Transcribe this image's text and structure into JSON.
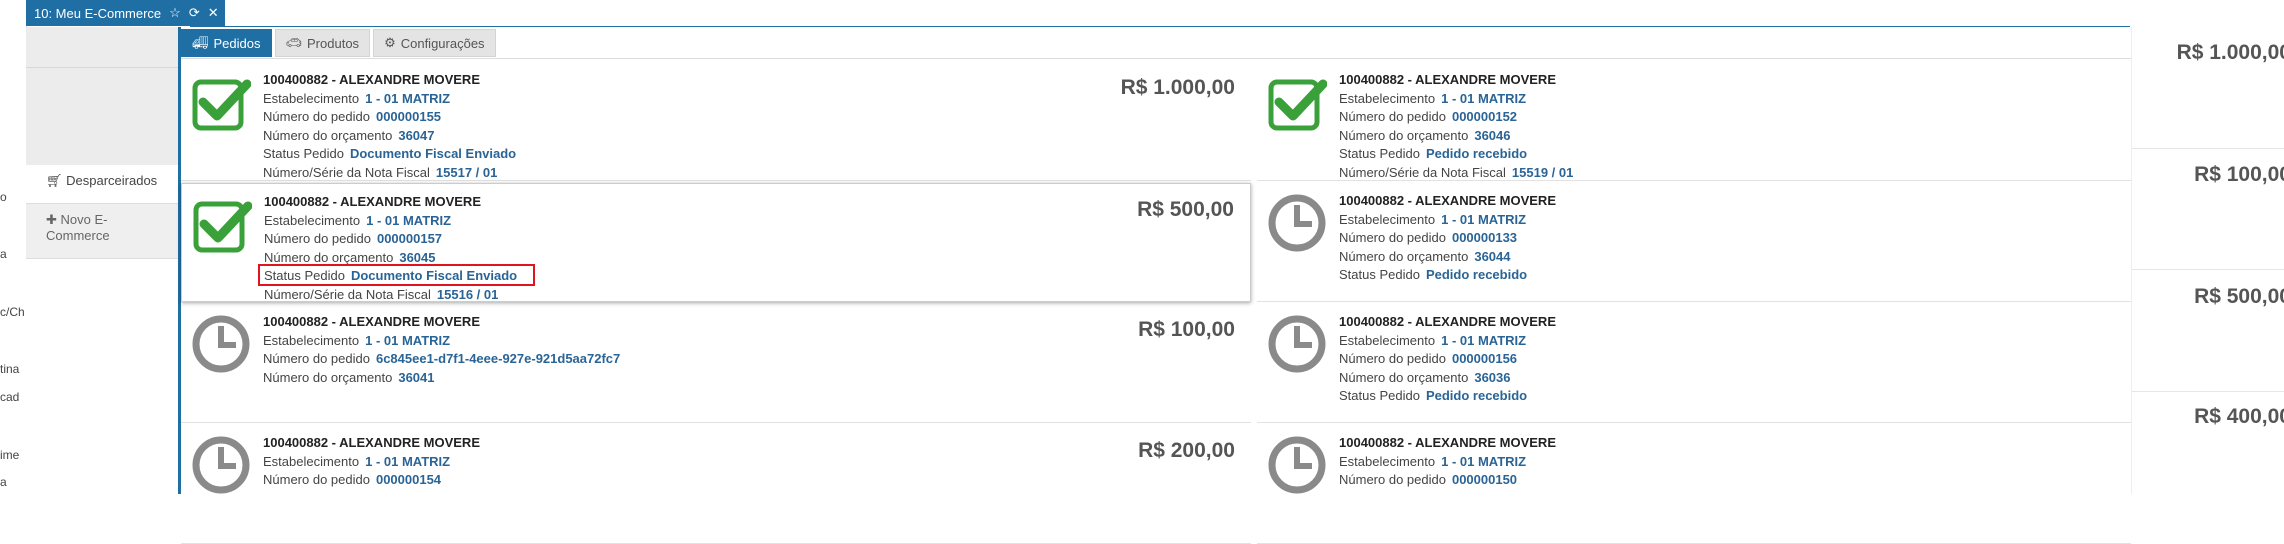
{
  "window": {
    "title": "10: Meu E-Commerce"
  },
  "left_strip": [
    "o",
    "a",
    "c/Ch",
    "tina",
    "cad",
    "ime",
    "a"
  ],
  "sidebar": {
    "items": [
      {
        "label": "Desparceirados",
        "icon": "cart-icon"
      },
      {
        "label": "Novo E-Commerce",
        "icon": "plus-icon"
      }
    ]
  },
  "tabs": [
    {
      "label": "Pedidos",
      "icon": "truck-icon",
      "active": true
    },
    {
      "label": "Produtos",
      "icon": "car-icon",
      "active": false
    },
    {
      "label": "Configurações",
      "icon": "gears-icon",
      "active": false
    }
  ],
  "labels": {
    "estabelecimento": "Estabelecimento",
    "numero_pedido": "Número do pedido",
    "numero_orcamento": "Número do orçamento",
    "status": "Status Pedido",
    "nota": "Número/Série da Nota Fiscal"
  },
  "orders": [
    {
      "title": "100400882 - ALEXANDRE MOVERE",
      "estabelecimento": "1 - 01 MATRIZ",
      "pedido": "000000155",
      "orcamento": "36047",
      "status": "Documento Fiscal Enviado",
      "nota": "15517 / 01",
      "amount": "R$ 1.000,00",
      "icon": "check-icon"
    },
    {
      "title": "100400882 - ALEXANDRE MOVERE",
      "estabelecimento": "1 - 01 MATRIZ",
      "pedido": "000000152",
      "orcamento": "36046",
      "status": "Pedido recebido",
      "nota": "15519 / 01",
      "amount": "R$ 1.000,00",
      "icon": "check-icon"
    },
    {
      "title": "100400882 - ALEXANDRE MOVERE",
      "estabelecimento": "1 - 01 MATRIZ",
      "pedido": "000000157",
      "orcamento": "36045",
      "status": "Documento Fiscal Enviado",
      "nota": "15516 / 01",
      "amount": "R$ 500,00",
      "icon": "check-icon"
    },
    {
      "title": "100400882 - ALEXANDRE MOVERE",
      "estabelecimento": "1 - 01 MATRIZ",
      "pedido": "000000133",
      "orcamento": "36044",
      "status": "Pedido recebido",
      "amount": "R$ 100,00",
      "icon": "clock-icon"
    },
    {
      "title": "100400882 - ALEXANDRE MOVERE",
      "estabelecimento": "1 - 01 MATRIZ",
      "pedido": "6c845ee1-d7f1-4eee-927e-921d5aa72fc7",
      "orcamento": "36041",
      "amount": "R$ 100,00",
      "icon": "clock-icon"
    },
    {
      "title": "100400882 - ALEXANDRE MOVERE",
      "estabelecimento": "1 - 01 MATRIZ",
      "pedido": "000000156",
      "orcamento": "36036",
      "status": "Pedido recebido",
      "amount": "R$ 500,00",
      "icon": "clock-icon"
    },
    {
      "title": "100400882 - ALEXANDRE MOVERE",
      "estabelecimento": "1 - 01 MATRIZ",
      "pedido": "000000154",
      "amount": "R$ 200,00",
      "icon": "clock-icon"
    },
    {
      "title": "100400882 - ALEXANDRE MOVERE",
      "estabelecimento": "1 - 01 MATRIZ",
      "pedido": "000000150",
      "amount": "R$ 400,00",
      "icon": "clock-icon"
    }
  ],
  "colors": {
    "accent": "#1f6fa5",
    "check": "#3aa13a",
    "clock": "#8a8a8a",
    "link": "#2a6496",
    "highlight": "#e0141e"
  }
}
